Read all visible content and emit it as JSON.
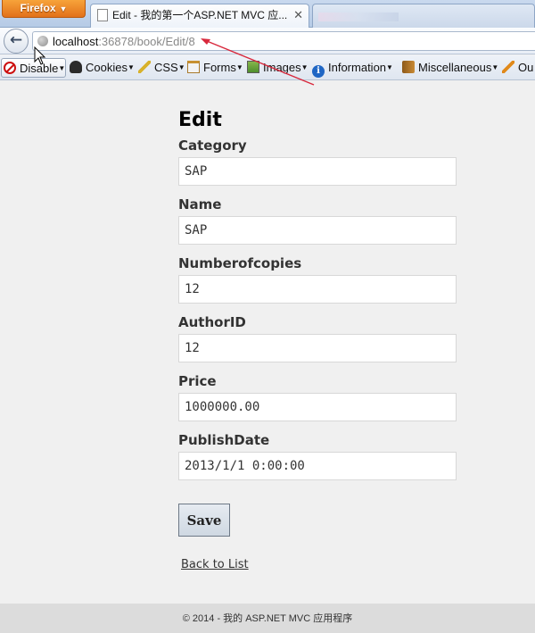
{
  "browser": {
    "app_button": "Firefox",
    "active_tab_title": "Edit - 我的第一个ASP.NET MVC 应...",
    "address": {
      "host": "localhost",
      "rest": ":36878/book/Edit/8"
    }
  },
  "devtoolbar": {
    "items": [
      "Disable",
      "Cookies",
      "CSS",
      "Forms",
      "Images",
      "Information",
      "Miscellaneous",
      "Ou"
    ]
  },
  "page": {
    "title": "Edit",
    "fields": [
      {
        "label": "Category",
        "value": "SAP"
      },
      {
        "label": "Name",
        "value": "SAP"
      },
      {
        "label": "Numberofcopies",
        "value": "12"
      },
      {
        "label": "AuthorID",
        "value": "12"
      },
      {
        "label": "Price",
        "value": "1000000.00"
      },
      {
        "label": "PublishDate",
        "value": "2013/1/1 0:00:00"
      }
    ],
    "save_label": "Save",
    "back_link": "Back to List"
  },
  "footer": {
    "text": "© 2014 - 我的 ASP.NET MVC 应用程序"
  },
  "colors": {
    "annotation_arrow": "#d8283c",
    "firefox_orange": "#e2711a"
  }
}
